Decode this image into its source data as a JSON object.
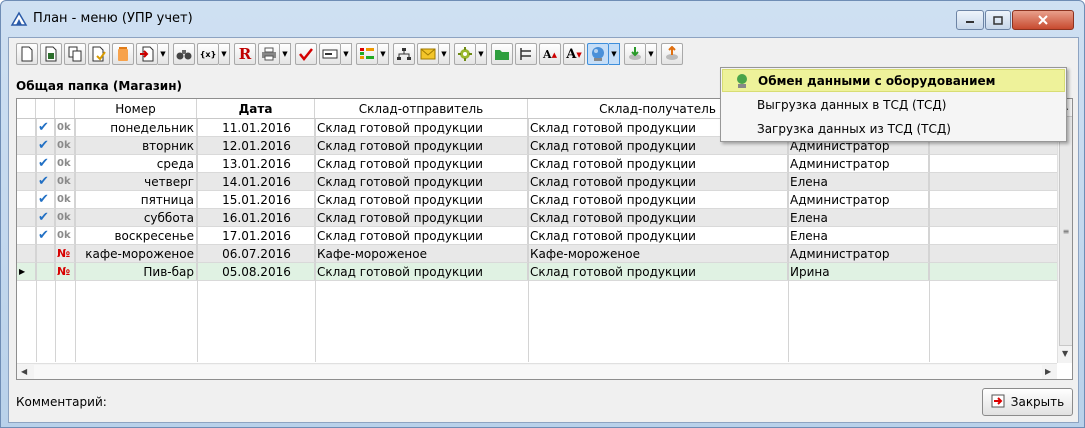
{
  "window": {
    "title": "План - меню (УПР учет)"
  },
  "toolbar": {
    "buttons": [
      "new-doc",
      "save",
      "copy",
      "open",
      "delete",
      "import",
      "find",
      "bracket",
      "report-r",
      "print",
      "check",
      "card",
      "columns",
      "tree",
      "mail",
      "settings",
      "folder",
      "list",
      "font-up",
      "font-down",
      "exchange",
      "download",
      "upload"
    ]
  },
  "folder": {
    "label": "Общая папка (Магазин)"
  },
  "grid": {
    "columns": [
      "Номер",
      "Дата",
      "Склад-отправитель",
      "Склад-получатель",
      ""
    ],
    "rows": [
      {
        "status": "ok",
        "num": "понедельник",
        "date": "11.01.2016",
        "from": "Склад готовой продукции",
        "to": "Склад готовой продукции",
        "user": ""
      },
      {
        "status": "ok",
        "num": "вторник",
        "date": "12.01.2016",
        "from": "Склад готовой продукции",
        "to": "Склад готовой продукции",
        "user": "Администратор"
      },
      {
        "status": "ok",
        "num": "среда",
        "date": "13.01.2016",
        "from": "Склад готовой продукции",
        "to": "Склад готовой продукции",
        "user": "Администратор"
      },
      {
        "status": "ok",
        "num": "четверг",
        "date": "14.01.2016",
        "from": "Склад готовой продукции",
        "to": "Склад готовой продукции",
        "user": "Елена"
      },
      {
        "status": "ok",
        "num": "пятница",
        "date": "15.01.2016",
        "from": "Склад готовой продукции",
        "to": "Склад готовой продукции",
        "user": "Администратор"
      },
      {
        "status": "ok",
        "num": "суббота",
        "date": "16.01.2016",
        "from": "Склад готовой продукции",
        "to": "Склад готовой продукции",
        "user": "Елена"
      },
      {
        "status": "ok",
        "num": "воскресенье",
        "date": "17.01.2016",
        "from": "Склад готовой продукции",
        "to": "Склад готовой продукции",
        "user": "Елена"
      },
      {
        "status": "no",
        "num": "кафе-мороженое",
        "date": "06.07.2016",
        "from": "Кафе-мороженое",
        "to": "Кафе-мороженое",
        "user": "Администратор"
      },
      {
        "status": "no",
        "num": "Пив-бар",
        "date": "05.08.2016",
        "from": "Склад готовой продукции",
        "to": "Склад готовой продукции",
        "user": "Ирина"
      }
    ]
  },
  "status_labels": {
    "ok": "0k",
    "no": "№"
  },
  "menu": {
    "items": [
      "Обмен данными с оборудованием",
      "Выгрузка данных в ТСД (ТСД)",
      "Загрузка данных из ТСД (ТСД)"
    ]
  },
  "footer": {
    "comment_label": "Комментарий:",
    "close_label": "Закрыть"
  }
}
